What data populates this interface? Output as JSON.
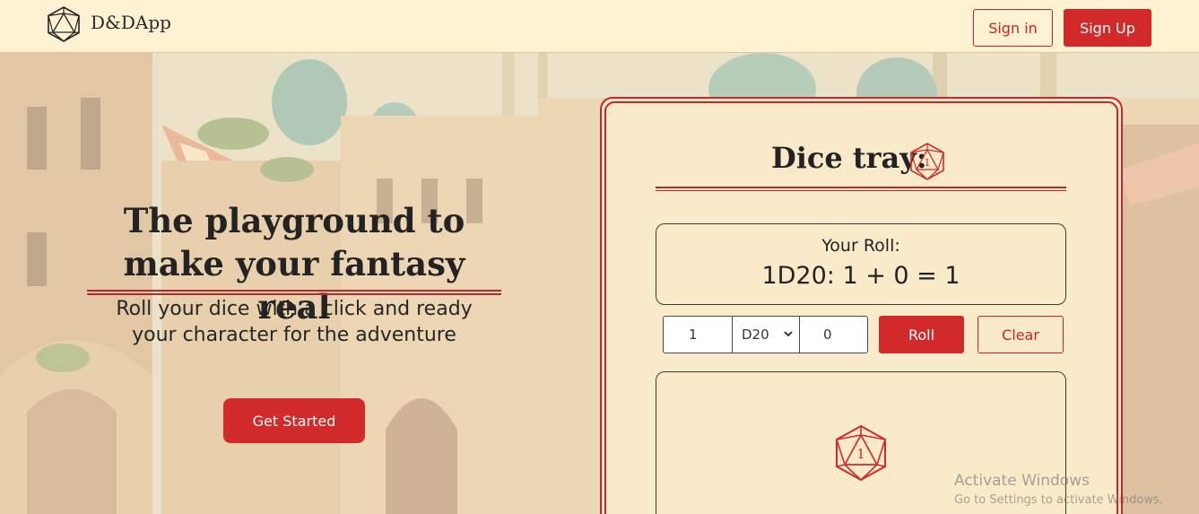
{
  "header": {
    "brand": "D&DApp",
    "sign_in_label": "Sign in",
    "sign_up_label": "Sign Up"
  },
  "hero": {
    "title_line1": "The playground to",
    "title_line2": "make your fantasy real",
    "subtitle_line1": "Roll your dice with a click and ready",
    "subtitle_line2": "your character for the adventure",
    "cta_label": "Get Started"
  },
  "dice_tray": {
    "title": "Dice tray:",
    "roll_label": "Your Roll:",
    "roll_result": "1D20: 1 + 0 = 1",
    "count_value": "1",
    "die_selected": "D20",
    "modifier_value": "0",
    "roll_button": "Roll",
    "clear_button": "Clear",
    "die_face": "1"
  },
  "os_watermark": {
    "line1": "Activate Windows",
    "line2": "Go to Settings to activate Windows."
  },
  "colors": {
    "accent": "#d22a2a",
    "header_bg": "#fef2d2",
    "text": "#232323"
  },
  "icons": {
    "logo": "d20-outline-icon",
    "tray_die": "d20-red-icon",
    "select_chevron": "chevron-down-icon"
  }
}
